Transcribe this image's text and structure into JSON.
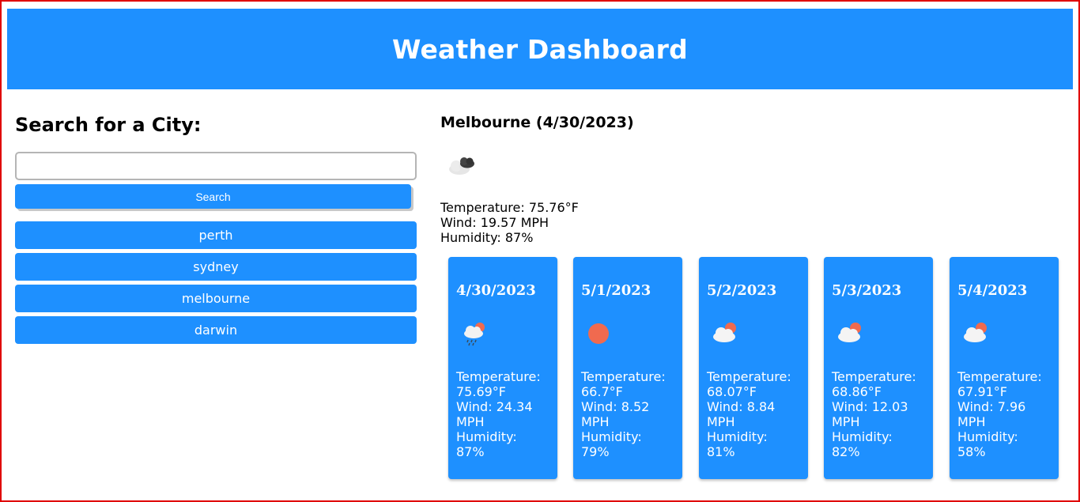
{
  "header": {
    "title": "Weather Dashboard"
  },
  "colors": {
    "accent": "#1e90ff",
    "frame": "#e00000",
    "sun": "#f06a4f"
  },
  "search": {
    "heading": "Search for a City:",
    "input_value": "",
    "input_placeholder": "",
    "button_label": "Search"
  },
  "history": [
    {
      "label": "perth"
    },
    {
      "label": "sydney"
    },
    {
      "label": "melbourne"
    },
    {
      "label": "darwin"
    }
  ],
  "current": {
    "title": "Melbourne (4/30/2023)",
    "icon": "broken-clouds-night-icon",
    "temperature": "Temperature: 75.76°F",
    "wind": "Wind: 19.57 MPH",
    "humidity": "Humidity: 87%"
  },
  "forecast": [
    {
      "date": "4/30/2023",
      "icon": "rain-icon",
      "temp_label": "Temperature:",
      "temp": "75.69°F",
      "wind_label": "Wind: 24.34",
      "wind_unit": "MPH",
      "humidity_label": "Humidity:",
      "humidity": "87%"
    },
    {
      "date": "5/1/2023",
      "icon": "sun-icon",
      "temp_label": "Temperature:",
      "temp": "66.7°F",
      "wind_label": "Wind: 8.52",
      "wind_unit": "MPH",
      "humidity_label": "Humidity:",
      "humidity": "79%"
    },
    {
      "date": "5/2/2023",
      "icon": "partly-cloudy-icon",
      "temp_label": "Temperature:",
      "temp": "68.07°F",
      "wind_label": "Wind: 8.84",
      "wind_unit": "MPH",
      "humidity_label": "Humidity:",
      "humidity": "81%"
    },
    {
      "date": "5/3/2023",
      "icon": "partly-cloudy-icon",
      "temp_label": "Temperature:",
      "temp": "68.86°F",
      "wind_label": "Wind: 12.03",
      "wind_unit": "MPH",
      "humidity_label": "Humidity:",
      "humidity": "82%"
    },
    {
      "date": "5/4/2023",
      "icon": "partly-cloudy-icon",
      "temp_label": "Temperature:",
      "temp": "67.91°F",
      "wind_label": "Wind: 7.96",
      "wind_unit": "MPH",
      "humidity_label": "Humidity:",
      "humidity": "58%"
    }
  ]
}
